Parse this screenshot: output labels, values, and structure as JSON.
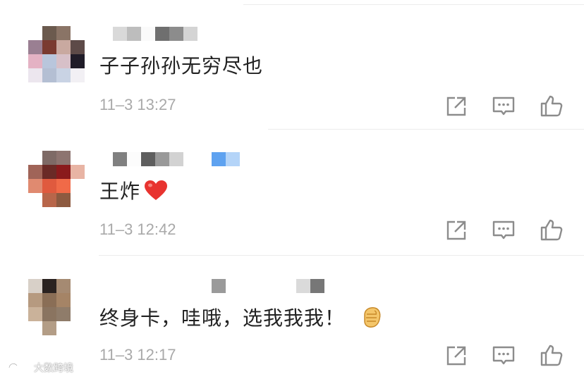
{
  "comments": [
    {
      "text": "子子孙孙无穷尽也",
      "time": "11–3 13:27"
    },
    {
      "text": "王炸",
      "time": "11–3 12:42"
    },
    {
      "text": "终身卡，哇哦，选我我我！",
      "time": "11–3 12:17"
    }
  ],
  "actions": {
    "share_icon": "share-icon",
    "reply_icon": "comment-icon",
    "like_icon": "thumbs-up-icon"
  },
  "watermark": {
    "text": "大数跨境"
  }
}
